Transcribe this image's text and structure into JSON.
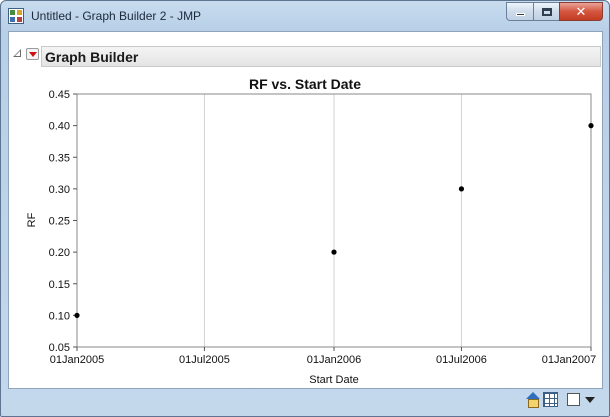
{
  "window": {
    "title": "Untitled - Graph Builder 2 - JMP",
    "minimize_glyph": "",
    "maximize_glyph": "",
    "close_glyph": "✕"
  },
  "outline": {
    "title": "Graph Builder"
  },
  "icons": [
    "jmp-app-icon",
    "disclosure-icon",
    "red-triangle-menu-icon",
    "home-icon",
    "data-table-icon",
    "checkbox-icon",
    "dropdown-arrow-icon"
  ],
  "chart_data": {
    "type": "scatter",
    "title": "RF vs. Start Date",
    "xlabel": "Start Date",
    "ylabel": "RF",
    "x_ticks": [
      "01Jan2005",
      "01Jul2005",
      "01Jan2006",
      "01Jul2006",
      "01Jan2007"
    ],
    "y_ticks": [
      "0.05",
      "0.10",
      "0.15",
      "0.20",
      "0.25",
      "0.30",
      "0.35",
      "0.40",
      "0.45"
    ],
    "xlim": [
      "2005-01-01",
      "2007-01-01"
    ],
    "ylim": [
      0.05,
      0.45
    ],
    "grid": "vertical",
    "points": [
      {
        "x": "2005-01-01",
        "y": 0.1
      },
      {
        "x": "2006-01-01",
        "y": 0.2
      },
      {
        "x": "2006-07-01",
        "y": 0.3
      },
      {
        "x": "2007-01-01",
        "y": 0.4
      }
    ],
    "point_color": "#000000"
  }
}
